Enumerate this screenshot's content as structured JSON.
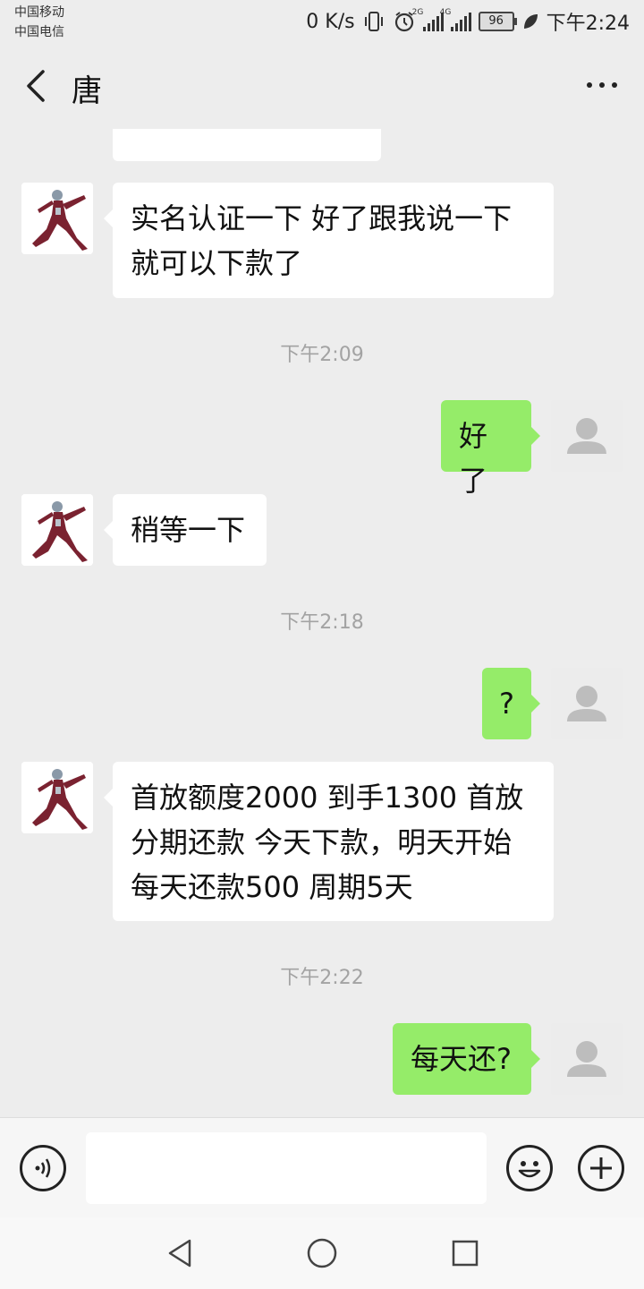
{
  "status_bar": {
    "carrier_1": "中国移动",
    "carrier_2": "中国电信",
    "net_speed": "0 K/s",
    "signal_1_tag": "2G",
    "signal_2_tag": "4G",
    "battery": "96",
    "time": "下午2:24"
  },
  "header": {
    "title": "唐"
  },
  "messages": [
    {
      "side": "in",
      "text_lines": [
        "实名认证一下  好了跟我说一下",
        "就可以下款了"
      ]
    },
    {
      "timestamp": "下午2:09"
    },
    {
      "side": "out",
      "text": "好了"
    },
    {
      "side": "in",
      "text": "稍等一下"
    },
    {
      "timestamp": "下午2:18"
    },
    {
      "side": "out",
      "text": "?"
    },
    {
      "side": "in",
      "text_lines": [
        "首放额度2000 到手1300 首放",
        "分期还款 今天下款，明天开始",
        "每天还款500  周期5天"
      ]
    },
    {
      "timestamp": "下午2:22"
    },
    {
      "side": "out",
      "text": "每天还?"
    }
  ],
  "input_bar": {
    "placeholder": ""
  },
  "colors": {
    "background": "#ededed",
    "incoming_bubble": "#ffffff",
    "outgoing_bubble": "#95ec69",
    "timestamp_text": "#a3a3a3"
  },
  "icons": {
    "back": "chevron-left-icon",
    "more": "more-dots-icon",
    "voice": "voice-icon",
    "emoji": "emoji-icon",
    "plus": "plus-icon",
    "nav_back": "triangle-back-icon",
    "nav_home": "circle-home-icon",
    "nav_recent": "square-recent-icon"
  }
}
